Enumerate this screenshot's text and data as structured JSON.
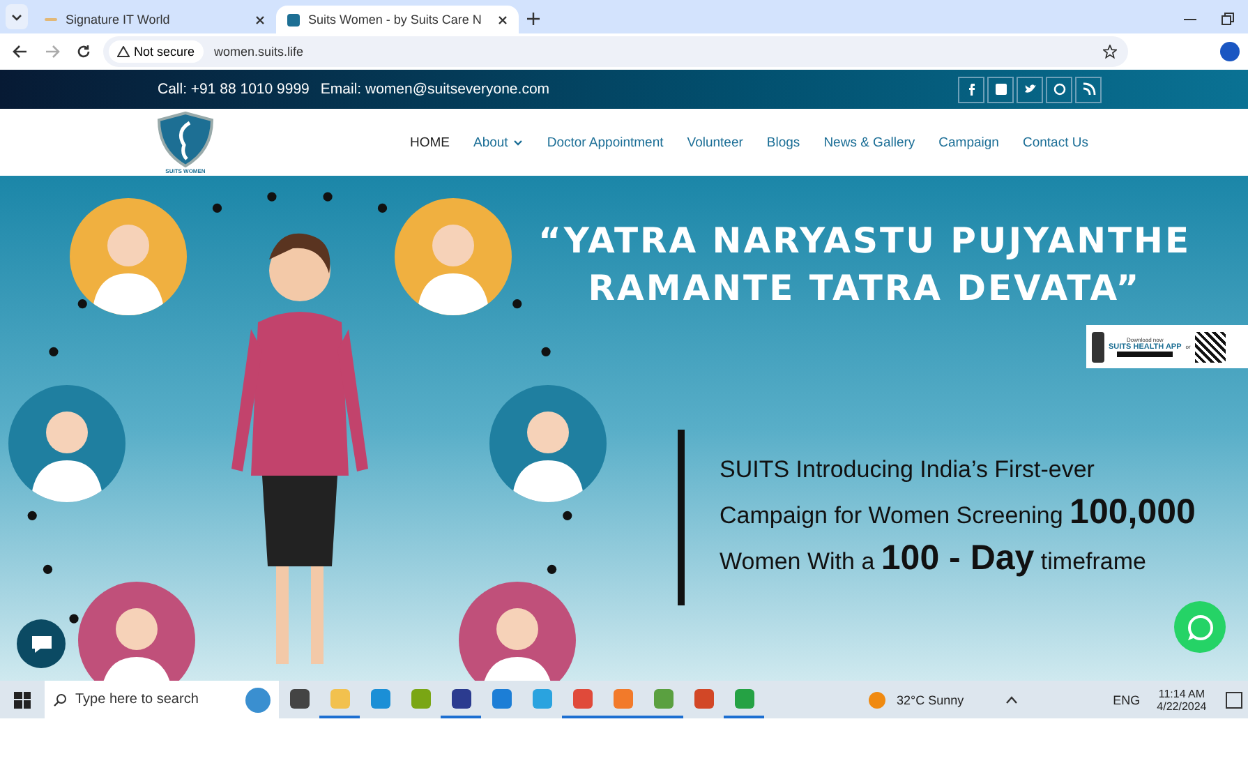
{
  "browser": {
    "tabs": [
      {
        "title": "Signature IT World",
        "selected": false
      },
      {
        "title": "Suits Women - by Suits Care N",
        "selected": true
      }
    ],
    "security": "Not secure",
    "url": "women.suits.life"
  },
  "topbar": {
    "call": "Call: +91 88 1010 9999",
    "email": "Email: women@suitseveryone.com"
  },
  "header": {
    "logo_text": "SUITS WOMEN",
    "nav": [
      {
        "label": "HOME",
        "selected": true,
        "dropdown": false
      },
      {
        "label": "About",
        "selected": false,
        "dropdown": true
      },
      {
        "label": "Doctor Appointment",
        "selected": false,
        "dropdown": false
      },
      {
        "label": "Volunteer",
        "selected": false,
        "dropdown": false
      },
      {
        "label": "Blogs",
        "selected": false,
        "dropdown": false
      },
      {
        "label": "News & Gallery",
        "selected": false,
        "dropdown": false
      },
      {
        "label": "Campaign",
        "selected": false,
        "dropdown": false
      },
      {
        "label": "Contact Us",
        "selected": false,
        "dropdown": false
      }
    ]
  },
  "hero": {
    "quote": [
      "“YATRA NARYASTU PUJYANTHE",
      "RAMANTE TATRA DEVATA”"
    ],
    "app_banner": {
      "small": "Download now",
      "title": "SUITS HEALTH APP",
      "or": "or"
    },
    "lines": [
      "SUITS Introducing India’s First-ever",
      "Campaign for Women Screening **100,000**",
      "Women With a **100 - Day** timeframe"
    ]
  },
  "taskbar": {
    "search_placeholder": "Type here to search",
    "apps": [
      {
        "kind": "taskview",
        "active": false
      },
      {
        "kind": "folder",
        "active": true
      },
      {
        "kind": "edge",
        "active": false
      },
      {
        "kind": "dw",
        "active": false
      },
      {
        "kind": "ps",
        "active": true
      },
      {
        "kind": "mail",
        "active": false
      },
      {
        "kind": "telegram",
        "active": false
      },
      {
        "kind": "chrome",
        "active": true
      },
      {
        "kind": "firefox",
        "active": true
      },
      {
        "kind": "image",
        "active": true
      },
      {
        "kind": "ppt",
        "active": false
      },
      {
        "kind": "whatsapp",
        "active": true
      }
    ],
    "weather": "32°C  Sunny",
    "lang": "ENG",
    "time": "11:14 AM",
    "date": "4/22/2024"
  }
}
